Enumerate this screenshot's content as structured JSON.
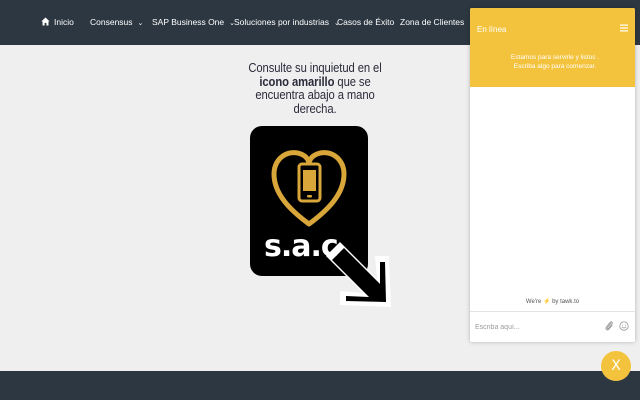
{
  "nav": {
    "items": [
      {
        "label": "Inicio",
        "icon": "home-icon"
      },
      {
        "label": "Consensus",
        "caret": "⌄"
      },
      {
        "label": "SAP Business One",
        "caret": "⌄"
      },
      {
        "label": "Soluciones por industrias",
        "caret": "⌄"
      },
      {
        "label": "Casos de Éxito"
      },
      {
        "label": "Zona de Clientes",
        "caret": "⌄"
      }
    ]
  },
  "main": {
    "instruction_pre": "Consulte su inquietud en el ",
    "instruction_bold": "icono amarillo",
    "instruction_post": " que se encuentra abajo a mano derecha.",
    "logo_text": "s.a.c"
  },
  "chat": {
    "status": "En línea",
    "welcome_line1": "Estamos para servirle y listos .",
    "welcome_line2": "Escriba algo para comenzar.",
    "brand_pre": "We're",
    "brand_bolt": "⚡",
    "brand_post": "by tawk.to",
    "input_placeholder": "Escriba aquí...",
    "close_label": "X"
  },
  "colors": {
    "nav_bg": "#2d3741",
    "page_bg": "#efefef",
    "accent_yellow": "#f3c33e",
    "logo_gold": "#d9a63a",
    "logo_black": "#000000"
  }
}
